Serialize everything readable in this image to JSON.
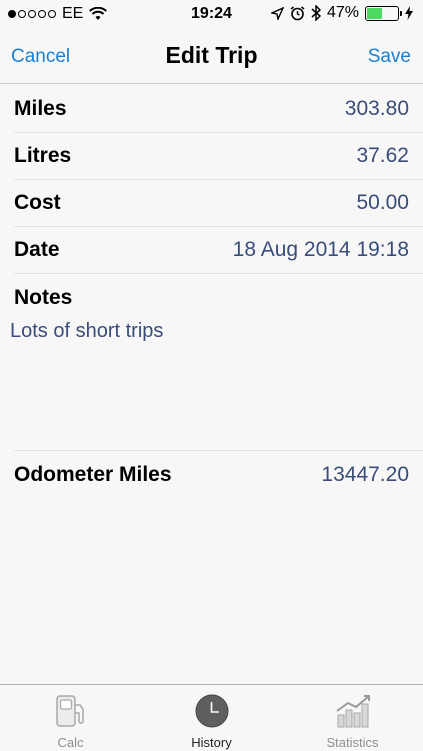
{
  "status": {
    "carrier": "EE",
    "time": "19:24",
    "battery": "47%",
    "battery_level": 0.47
  },
  "nav": {
    "cancel": "Cancel",
    "title": "Edit Trip",
    "save": "Save"
  },
  "fields": [
    {
      "label": "Miles",
      "value": "303.80"
    },
    {
      "label": "Litres",
      "value": "37.62"
    },
    {
      "label": "Cost",
      "value": "50.00"
    },
    {
      "label": "Date",
      "value": "18 Aug 2014 19:18"
    }
  ],
  "notes": {
    "label": "Notes",
    "text": "Lots of short trips"
  },
  "odometer": {
    "label": "Odometer Miles",
    "value": "13447.20"
  },
  "tabs": [
    {
      "label": "Calc",
      "icon": "fuel-pump-icon",
      "active": false
    },
    {
      "label": "History",
      "icon": "clock-icon",
      "active": true
    },
    {
      "label": "Statistics",
      "icon": "chart-icon",
      "active": false
    }
  ],
  "colors": {
    "tint": "#1a7fd1",
    "value_text": "#3a4d7a",
    "battery_fill": "#4cd964"
  }
}
